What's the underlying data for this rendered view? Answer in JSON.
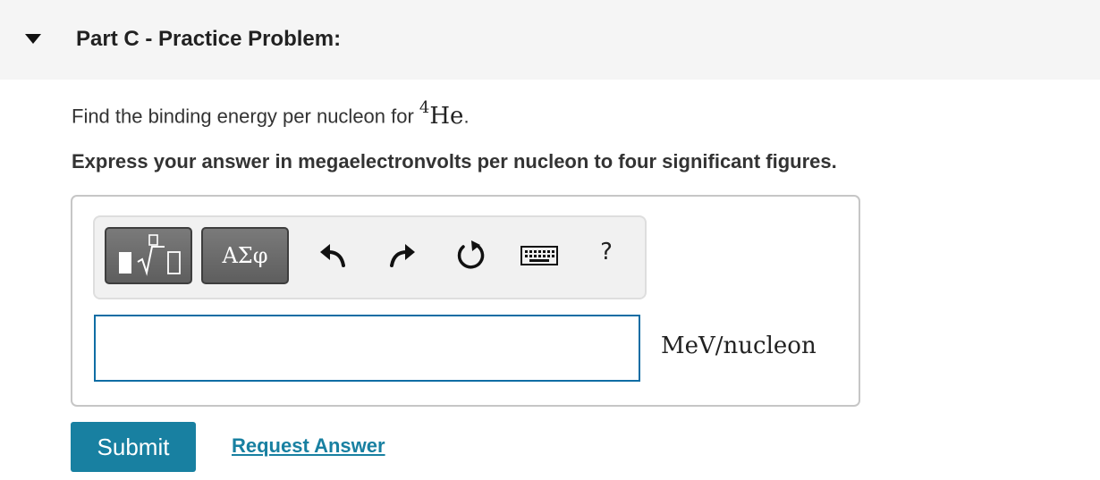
{
  "part": {
    "title": "Part C - Practice Problem:"
  },
  "problem": {
    "question_prefix": "Find the binding energy per nucleon for ",
    "nuclide_mass_number": "4",
    "nuclide_symbol": "He",
    "question_suffix": ".",
    "instruction": "Express your answer in megaelectronvolts per nucleon to four significant figures."
  },
  "toolbar": {
    "templates_icon": "templates-sqrt-icon",
    "symbols_label": "ΑΣφ",
    "undo_icon": "undo-icon",
    "redo_icon": "redo-icon",
    "reset_icon": "reset-icon",
    "keyboard_icon": "keyboard-icon",
    "help_label": "?"
  },
  "answer": {
    "value": "",
    "unit": "MeV/nucleon"
  },
  "actions": {
    "submit_label": "Submit",
    "request_label": "Request Answer"
  },
  "colors": {
    "accent": "#1880a1",
    "input_border": "#0f6da4",
    "header_bg": "#f5f5f5"
  }
}
